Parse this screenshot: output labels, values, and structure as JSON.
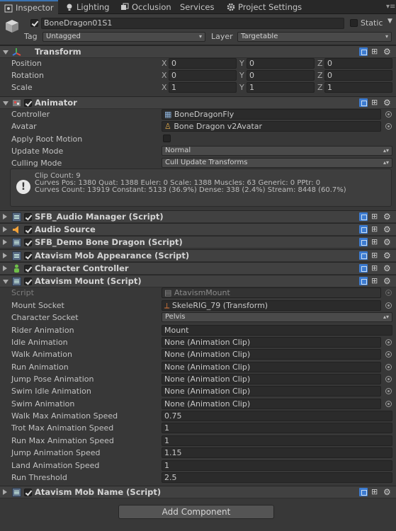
{
  "tabs": [
    {
      "label": "Inspector",
      "icon": "inspector-icon"
    },
    {
      "label": "Lighting",
      "icon": "lighting-icon"
    },
    {
      "label": "Occlusion",
      "icon": "occlusion-icon"
    },
    {
      "label": "Services",
      "icon": "cloud-icon"
    },
    {
      "label": "Project Settings",
      "icon": "gear-icon"
    }
  ],
  "object": {
    "name": "BoneDragon01S1",
    "static_label": "Static",
    "tag_label": "Tag",
    "tag_value": "Untagged",
    "layer_label": "Layer",
    "layer_value": "Targetable"
  },
  "transform": {
    "title": "Transform",
    "rows": [
      {
        "label": "Position",
        "x": "0",
        "y": "0",
        "z": "0"
      },
      {
        "label": "Rotation",
        "x": "0",
        "y": "0",
        "z": "0"
      },
      {
        "label": "Scale",
        "x": "1",
        "y": "1",
        "z": "1"
      }
    ],
    "axes": [
      "X",
      "Y",
      "Z"
    ]
  },
  "animator": {
    "title": "Animator",
    "controller_label": "Controller",
    "controller_value": "BoneDragonFly",
    "avatar_label": "Avatar",
    "avatar_value": "Bone Dragon v2Avatar",
    "root_motion_label": "Apply Root Motion",
    "update_mode_label": "Update Mode",
    "update_mode_value": "Normal",
    "culling_mode_label": "Culling Mode",
    "culling_mode_value": "Cull Update Transforms",
    "info_lines": "Clip Count: 9\nCurves Pos: 1380 Quat: 1388 Euler: 0 Scale: 1388 Muscles: 63 Generic: 0 PPtr: 0\nCurves Count: 13919 Constant: 5133 (36.9%) Dense: 338 (2.4%) Stream: 8448 (60.7%)"
  },
  "collapsed_components": [
    {
      "title": "SFB_Audio Manager (Script)",
      "icon": "script-icon"
    },
    {
      "title": "Audio Source",
      "icon": "speaker-icon"
    },
    {
      "title": "SFB_Demo Bone Dragon (Script)",
      "icon": "script-icon"
    },
    {
      "title": "Atavism Mob Appearance (Script)",
      "icon": "script-icon"
    },
    {
      "title": "Character Controller",
      "icon": "character-controller-icon"
    }
  ],
  "mount": {
    "title": "Atavism Mount (Script)",
    "script_label": "Script",
    "script_value": "AtavismMount",
    "mount_socket_label": "Mount Socket",
    "mount_socket_value": "SkeleRIG_79 (Transform)",
    "char_socket_label": "Character Socket",
    "char_socket_value": "Pelvis",
    "rider_anim_label": "Rider Animation",
    "rider_anim_value": "Mount",
    "clip_rows": [
      {
        "label": "Idle Animation",
        "value": "None (Animation Clip)"
      },
      {
        "label": "Walk Animation",
        "value": "None (Animation Clip)"
      },
      {
        "label": "Run Animation",
        "value": "None (Animation Clip)"
      },
      {
        "label": "Jump Pose Animation",
        "value": "None (Animation Clip)"
      },
      {
        "label": "Swim Idle Animation",
        "value": "None (Animation Clip)"
      },
      {
        "label": "Swim Animation",
        "value": "None (Animation Clip)"
      }
    ],
    "num_rows": [
      {
        "label": "Walk Max Animation Speed",
        "value": "0.75"
      },
      {
        "label": "Trot Max Animation Speed",
        "value": "1"
      },
      {
        "label": "Run Max Animation Speed",
        "value": "1"
      },
      {
        "label": "Jump Animation Speed",
        "value": "1.15"
      },
      {
        "label": "Land Animation Speed",
        "value": "1"
      },
      {
        "label": "Run Threshold",
        "value": "2.5"
      }
    ]
  },
  "mob_name": {
    "title": "Atavism Mob Name (Script)"
  },
  "add_component_label": "Add Component",
  "colors": {
    "accent": "#3a72b0",
    "bg": "#383838",
    "field": "#2b2b2b"
  }
}
